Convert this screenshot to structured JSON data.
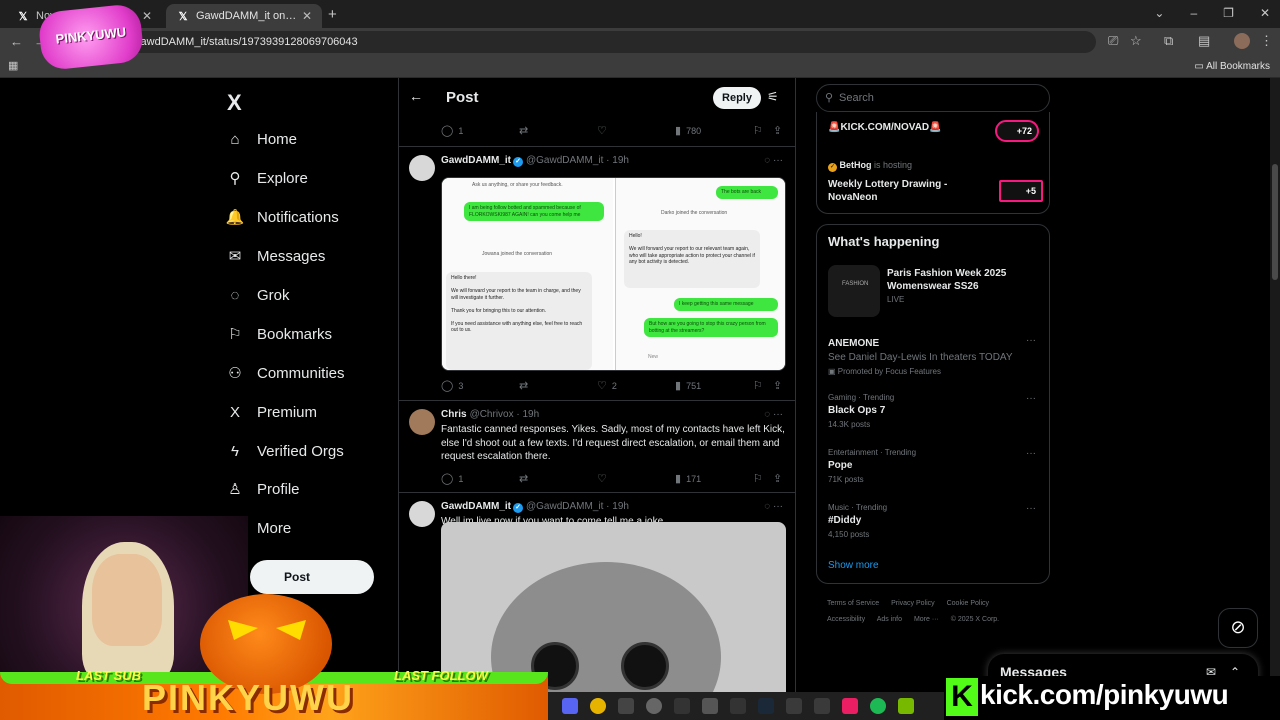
{
  "browser": {
    "tabs": [
      {
        "label": "Nova Neon /",
        "icon": "x-logo-icon"
      },
      {
        "label": "GawdDAMM_it on X: \"Really sta",
        "icon": "x-logo-icon"
      }
    ],
    "url": "GawdDAMM_it/status/1973939128069706043",
    "all_bookmarks": "All Bookmarks"
  },
  "overlay": {
    "logo": "PINKYUWU",
    "last_sub": "LAST SUB",
    "last_follow": "LAST FOLLOW",
    "brand": "PINKYUWU",
    "kick": "kick.com/pinkyuwu",
    "kick_letter": "K"
  },
  "nav": {
    "logo": "X",
    "items": [
      {
        "label": "Home",
        "icon": "home-icon",
        "glyph": "⌂"
      },
      {
        "label": "Explore",
        "icon": "search-icon",
        "glyph": "⚲"
      },
      {
        "label": "Notifications",
        "icon": "bell-icon",
        "glyph": "🔔"
      },
      {
        "label": "Messages",
        "icon": "mail-icon",
        "glyph": "✉"
      },
      {
        "label": "Grok",
        "icon": "grok-icon",
        "glyph": "◌"
      },
      {
        "label": "Bookmarks",
        "icon": "bookmark-icon",
        "glyph": "⚐"
      },
      {
        "label": "Communities",
        "icon": "communities-icon",
        "glyph": "⚇"
      },
      {
        "label": "Premium",
        "icon": "x-premium-icon",
        "glyph": "X"
      },
      {
        "label": "Verified Orgs",
        "icon": "lightning-icon",
        "glyph": "ϟ"
      },
      {
        "label": "Profile",
        "icon": "person-icon",
        "glyph": "♙"
      },
      {
        "label": "More",
        "icon": "more-icon",
        "glyph": "⋯"
      }
    ],
    "post_button": "Post"
  },
  "timeline": {
    "title": "Post",
    "reply_button": "Reply",
    "prev_actions": {
      "replies": "1",
      "views": "780"
    },
    "tweets": [
      {
        "name": "GawdDAMM_it",
        "handle": "@GawdDAMM_it · 19h",
        "actions": {
          "replies": "3",
          "likes": "2",
          "views": "751"
        },
        "media": {
          "left_top": "Ask us anything, or share your feedback.",
          "left_green": "I am being follow botted and spammed because of FLORKOWSKI987 AGAIN! can you come help me",
          "left_join": "Jowana joined the conversation",
          "left_reply_1": "Hello there!",
          "left_reply_2": "We will forward your report to the team in charge, and they will investigate it further.",
          "left_reply_3": "Thank you for bringing this to our attention.",
          "left_reply_4": "If you need assistance with anything else, feel free to reach out to us.",
          "right_green_1": "The bots are back",
          "right_join": "Darko joined the conversation",
          "right_reply_1": "Hello!",
          "right_reply_2": "We will forward your report to our relevant team again, who will take appropriate action to protect your channel if any bot activity is detected.",
          "right_green_2": "I keep getting this same message",
          "right_green_3": "But how are you going to stop this crazy person from botting at the streamers?",
          "right_new": "New"
        }
      },
      {
        "name": "Chris",
        "handle": "@Chrivox · 19h",
        "text": "Fantastic canned responses. Yikes. Sadly, most of my contacts have left Kick, else I'd shoot out a few texts. I'd request direct escalation, or email them and request escalation there.",
        "actions": {
          "replies": "1",
          "views": "171"
        }
      },
      {
        "name": "GawdDAMM_it",
        "handle": "@GawdDAMM_it · 19h",
        "text": "Well im live now if you want to come tell me a joke."
      }
    ]
  },
  "right": {
    "search_placeholder": "Search",
    "live": {
      "title": "🚨KICK.COM/NOVAD🚨",
      "badge1": "+72",
      "host_name": "BetHog",
      "host_text": "is hosting",
      "event": "Weekly Lottery Drawing - NovaNeon",
      "badge2": "+5"
    },
    "whats_happening": {
      "title": "What's happening",
      "featured": {
        "thumb": "FASHION",
        "title": "Paris Fashion Week 2025 Womenswear SS26",
        "status": "LIVE"
      },
      "trends": [
        {
          "cat": "",
          "name": "ANEMONE",
          "sub": "See Daniel Day-Lewis In theaters TODAY",
          "count": "Promoted by Focus Features"
        },
        {
          "cat": "Gaming · Trending",
          "name": "Black Ops 7",
          "sub": "",
          "count": "14.3K posts"
        },
        {
          "cat": "Entertainment · Trending",
          "name": "Pope",
          "sub": "",
          "count": "71K posts"
        },
        {
          "cat": "Music · Trending",
          "name": "#Diddy",
          "sub": "",
          "count": "4,150 posts"
        }
      ],
      "show_more": "Show more"
    },
    "footer": [
      "Terms of Service",
      "Privacy Policy",
      "Cookie Policy",
      "Accessibility",
      "Ads info",
      "More ···",
      "© 2025 X Corp."
    ],
    "messages": "Messages"
  }
}
